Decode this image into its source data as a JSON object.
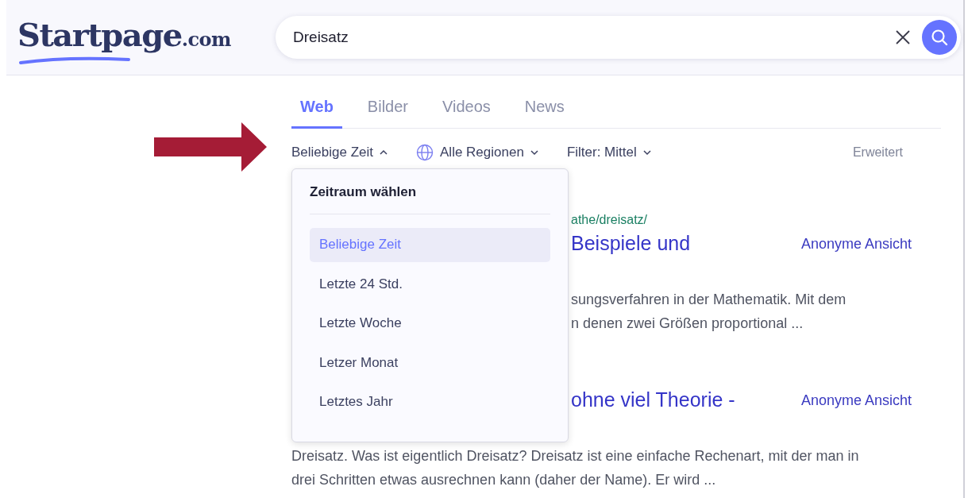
{
  "logo": {
    "name": "Startpage",
    "suffix": ".com"
  },
  "search": {
    "value": "Dreisatz"
  },
  "tabs": [
    {
      "label": "Web",
      "selected": true
    },
    {
      "label": "Bilder",
      "selected": false
    },
    {
      "label": "Videos",
      "selected": false
    },
    {
      "label": "News",
      "selected": false
    }
  ],
  "filters": [
    {
      "label": "Beliebige Zeit",
      "expanded": true,
      "kind": "plain"
    },
    {
      "label": "Alle Regionen",
      "expanded": false,
      "kind": "globe"
    },
    {
      "label": "Filter: Mittel",
      "expanded": false,
      "kind": "plain"
    }
  ],
  "advanced": "Erweitert",
  "dropdown": {
    "heading": "Zeitraum wählen",
    "items": [
      {
        "label": "Beliebige Zeit",
        "selected": true
      },
      {
        "label": "Letzte 24 Std.",
        "selected": false
      },
      {
        "label": "Letzte Woche",
        "selected": false
      },
      {
        "label": "Letzer Monat",
        "selected": false
      },
      {
        "label": "Letztes Jahr",
        "selected": false
      }
    ]
  },
  "results": [
    {
      "url": "athe/dreisatz/",
      "title": "Beispiele und",
      "anonymous_view": "Anonyme Ansicht",
      "snippet": [
        {
          "text": "sungsverfahren in der Mathematik. Mit dem",
          "kind": "clipped"
        },
        {
          "text": "n denen zwei Größen proportional ...",
          "kind": "clipped"
        }
      ]
    },
    {
      "title": "ohne viel Theorie -",
      "anonymous_view": "Anonyme Ansicht",
      "snippet": [
        {
          "text": "Dreisatz. Was ist eigentlich Dreisatz? Dreisatz ist eine einfache Rechenart, mit der man in",
          "kind": "full"
        },
        {
          "text": "drei Schritten etwas ausrechnen kann (daher der Name). Er wird ...",
          "kind": "full"
        }
      ]
    }
  ]
}
